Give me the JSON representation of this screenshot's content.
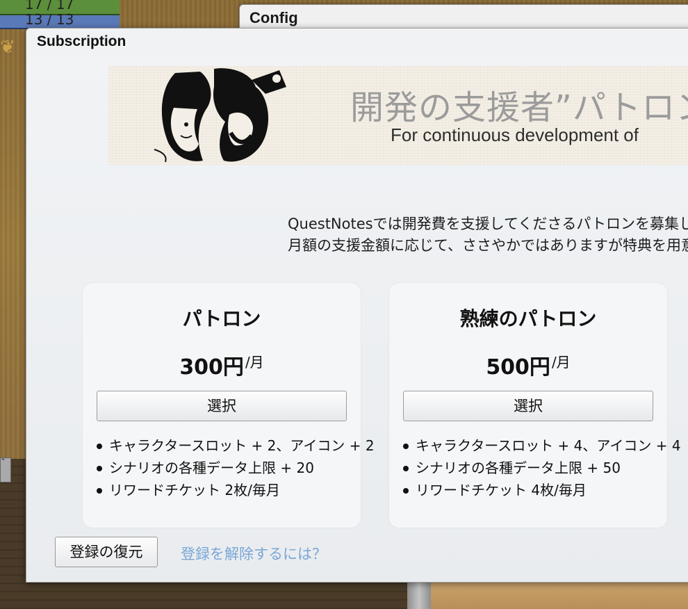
{
  "game": {
    "hp_text": "17 / 17",
    "mp_text": "13 / 13"
  },
  "config_window": {
    "title": "Config"
  },
  "subscription_window": {
    "title": "Subscription",
    "banner": {
      "heading": "開発の支援者”パトロン",
      "subheading": "For continuous development of"
    },
    "description": [
      "QuestNotesでは開発費を支援してくださるパトロンを募集して",
      "月額の支援金額に応じて、ささやかではありますが特典を用意"
    ],
    "plans": [
      {
        "name": "パトロン",
        "price": "300円",
        "per": "/月",
        "select_label": "選択",
        "features": [
          "キャラクタースロット + 2、アイコン + 2",
          "シナリオの各種データ上限 + 20",
          "リワードチケット 2枚/毎月"
        ]
      },
      {
        "name": "熟練のパトロン",
        "price": "500円",
        "per": "/月",
        "select_label": "選択",
        "features": [
          "キャラクタースロット + 4、アイコン + 4",
          "シナリオの各種データ上限 + 50",
          "リワードチケット 4枚/毎月"
        ]
      }
    ],
    "restore_label": "登録の復元",
    "cancel_link": "登録を解除するには？"
  }
}
